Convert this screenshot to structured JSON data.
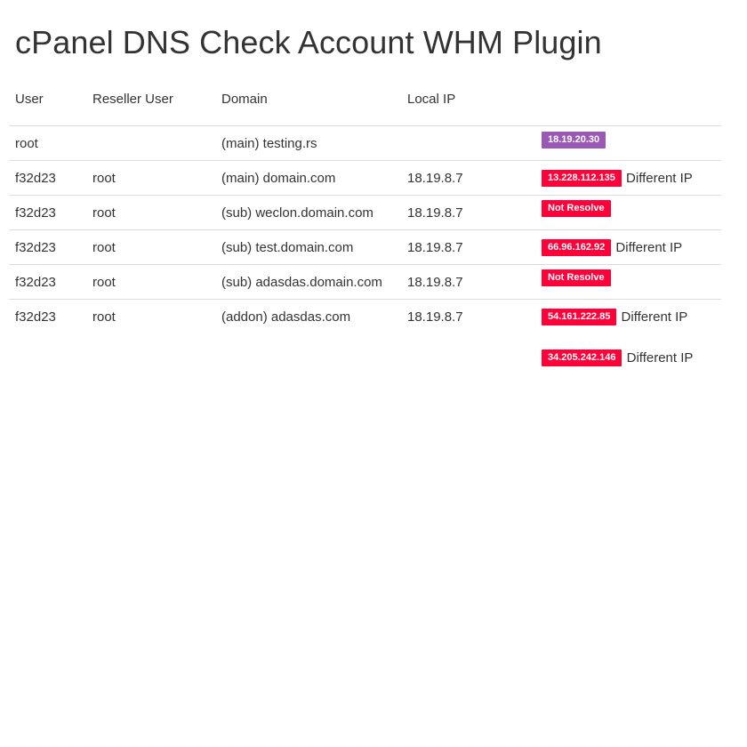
{
  "page": {
    "title": "cPanel DNS Check Account WHM Plugin"
  },
  "colors": {
    "badge_ok": "#9b59b6",
    "badge_bad": "#ff0039",
    "text": "#333333",
    "row_border": "#dddddd"
  },
  "table": {
    "headers": {
      "user": "User",
      "reseller": "Reseller User",
      "domain": "Domain",
      "local_ip": "Local IP",
      "status": ""
    },
    "rows": [
      {
        "user": "root",
        "reseller": "",
        "domain": "(main) testing.rs",
        "local_ip": "",
        "status": [
          {
            "badge": "18.19.20.30",
            "badge_type": "ok",
            "note": ""
          }
        ]
      },
      {
        "user": "f32d23",
        "reseller": "root",
        "domain": "(main) domain.com",
        "local_ip": "18.19.8.7",
        "status": [
          {
            "badge": "13.228.112.135",
            "badge_type": "bad",
            "note": "Different IP"
          }
        ]
      },
      {
        "user": "f32d23",
        "reseller": "root",
        "domain": "(sub) weclon.domain.com",
        "local_ip": "18.19.8.7",
        "status": [
          {
            "badge": "Not Resolve",
            "badge_type": "bad",
            "note": ""
          }
        ]
      },
      {
        "user": "f32d23",
        "reseller": "root",
        "domain": "(sub) test.domain.com",
        "local_ip": "18.19.8.7",
        "status": [
          {
            "badge": "66.96.162.92",
            "badge_type": "bad",
            "note": "Different IP"
          }
        ]
      },
      {
        "user": "f32d23",
        "reseller": "root",
        "domain": "(sub) adasdas.domain.com",
        "local_ip": "18.19.8.7",
        "status": [
          {
            "badge": "Not Resolve",
            "badge_type": "bad",
            "note": ""
          }
        ]
      },
      {
        "user": "f32d23",
        "reseller": "root",
        "domain": "(addon) adasdas.com",
        "local_ip": "18.19.8.7",
        "status": [
          {
            "badge": "54.161.222.85",
            "badge_type": "bad",
            "note": "Different IP"
          },
          {
            "badge": "34.205.242.146",
            "badge_type": "bad",
            "note": "Different IP"
          }
        ]
      }
    ]
  }
}
